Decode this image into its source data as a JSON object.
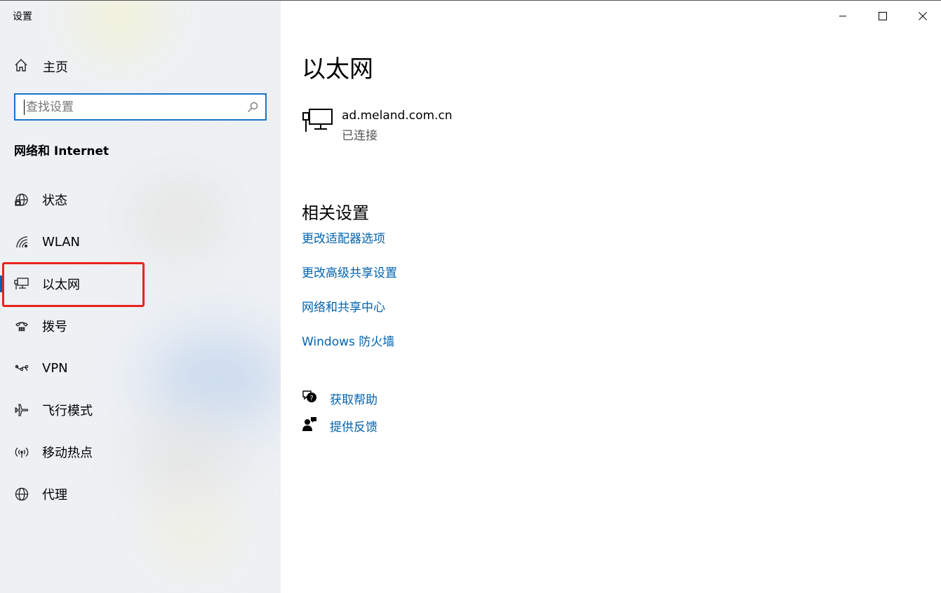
{
  "window": {
    "title": "设置",
    "controls": {
      "minimize": "minimize-icon",
      "maximize": "maximize-icon",
      "close": "close-icon"
    }
  },
  "sidebar": {
    "home_label": "主页",
    "search_placeholder": "查找设置",
    "section_title": "网络和 Internet",
    "items": [
      {
        "label": "状态",
        "icon": "status-globe-icon"
      },
      {
        "label": "WLAN",
        "icon": "wifi-icon"
      },
      {
        "label": "以太网",
        "icon": "ethernet-icon",
        "active": true
      },
      {
        "label": "拨号",
        "icon": "dialup-icon"
      },
      {
        "label": "VPN",
        "icon": "vpn-icon"
      },
      {
        "label": "飞行模式",
        "icon": "airplane-icon"
      },
      {
        "label": "移动热点",
        "icon": "hotspot-icon"
      },
      {
        "label": "代理",
        "icon": "proxy-globe-icon"
      }
    ]
  },
  "main": {
    "title": "以太网",
    "connection": {
      "name": "ad.meland.com.cn",
      "status": "已连接"
    },
    "related_title": "相关设置",
    "related_links": [
      "更改适配器选项",
      "更改高级共享设置",
      "网络和共享中心",
      "Windows 防火墙"
    ],
    "help": {
      "get_help": "获取帮助",
      "feedback": "提供反馈"
    }
  },
  "colors": {
    "accent": "#0063b1",
    "highlight": "#e8231f",
    "search_border": "#1a73c8"
  }
}
